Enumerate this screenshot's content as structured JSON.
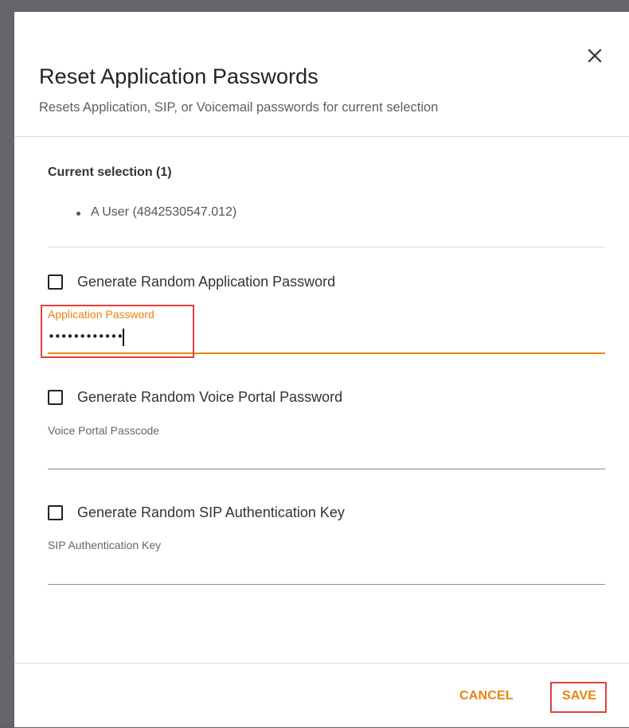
{
  "dialog": {
    "title": "Reset Application Passwords",
    "subtitle": "Resets Application, SIP, or Voicemail passwords for current selection",
    "close_icon": "close-icon"
  },
  "selection": {
    "heading": "Current selection (1)",
    "items": [
      "A User (4842530547.012)"
    ]
  },
  "application": {
    "checkbox_label": "Generate Random Application Password",
    "checked": false,
    "field_label": "Application Password",
    "field_value": "••••••••••••"
  },
  "voice_portal": {
    "checkbox_label": "Generate Random Voice Portal Password",
    "checked": false,
    "field_label": "Voice Portal Passcode",
    "field_value": ""
  },
  "sip": {
    "checkbox_label": "Generate Random SIP Authentication Key",
    "checked": false,
    "field_label": "SIP Authentication Key",
    "field_value": ""
  },
  "footer": {
    "cancel_label": "CANCEL",
    "save_label": "SAVE"
  },
  "colors": {
    "accent": "#e8850d",
    "annotation": "#e0403a"
  }
}
